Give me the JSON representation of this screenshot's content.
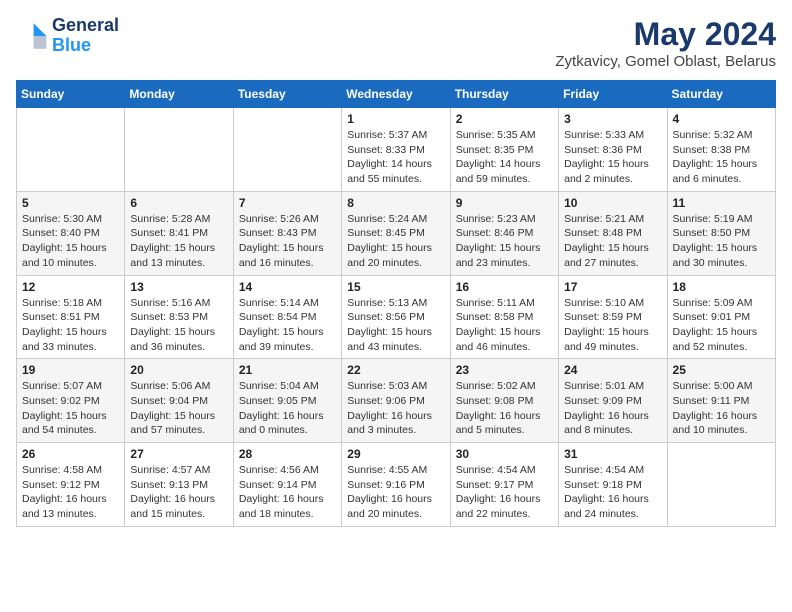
{
  "header": {
    "logo_line1": "General",
    "logo_line2": "Blue",
    "month": "May 2024",
    "location": "Zytkavicy, Gomel Oblast, Belarus"
  },
  "weekdays": [
    "Sunday",
    "Monday",
    "Tuesday",
    "Wednesday",
    "Thursday",
    "Friday",
    "Saturday"
  ],
  "weeks": [
    [
      {
        "day": "",
        "info": ""
      },
      {
        "day": "",
        "info": ""
      },
      {
        "day": "",
        "info": ""
      },
      {
        "day": "1",
        "info": "Sunrise: 5:37 AM\nSunset: 8:33 PM\nDaylight: 14 hours\nand 55 minutes."
      },
      {
        "day": "2",
        "info": "Sunrise: 5:35 AM\nSunset: 8:35 PM\nDaylight: 14 hours\nand 59 minutes."
      },
      {
        "day": "3",
        "info": "Sunrise: 5:33 AM\nSunset: 8:36 PM\nDaylight: 15 hours\nand 2 minutes."
      },
      {
        "day": "4",
        "info": "Sunrise: 5:32 AM\nSunset: 8:38 PM\nDaylight: 15 hours\nand 6 minutes."
      }
    ],
    [
      {
        "day": "5",
        "info": "Sunrise: 5:30 AM\nSunset: 8:40 PM\nDaylight: 15 hours\nand 10 minutes."
      },
      {
        "day": "6",
        "info": "Sunrise: 5:28 AM\nSunset: 8:41 PM\nDaylight: 15 hours\nand 13 minutes."
      },
      {
        "day": "7",
        "info": "Sunrise: 5:26 AM\nSunset: 8:43 PM\nDaylight: 15 hours\nand 16 minutes."
      },
      {
        "day": "8",
        "info": "Sunrise: 5:24 AM\nSunset: 8:45 PM\nDaylight: 15 hours\nand 20 minutes."
      },
      {
        "day": "9",
        "info": "Sunrise: 5:23 AM\nSunset: 8:46 PM\nDaylight: 15 hours\nand 23 minutes."
      },
      {
        "day": "10",
        "info": "Sunrise: 5:21 AM\nSunset: 8:48 PM\nDaylight: 15 hours\nand 27 minutes."
      },
      {
        "day": "11",
        "info": "Sunrise: 5:19 AM\nSunset: 8:50 PM\nDaylight: 15 hours\nand 30 minutes."
      }
    ],
    [
      {
        "day": "12",
        "info": "Sunrise: 5:18 AM\nSunset: 8:51 PM\nDaylight: 15 hours\nand 33 minutes."
      },
      {
        "day": "13",
        "info": "Sunrise: 5:16 AM\nSunset: 8:53 PM\nDaylight: 15 hours\nand 36 minutes."
      },
      {
        "day": "14",
        "info": "Sunrise: 5:14 AM\nSunset: 8:54 PM\nDaylight: 15 hours\nand 39 minutes."
      },
      {
        "day": "15",
        "info": "Sunrise: 5:13 AM\nSunset: 8:56 PM\nDaylight: 15 hours\nand 43 minutes."
      },
      {
        "day": "16",
        "info": "Sunrise: 5:11 AM\nSunset: 8:58 PM\nDaylight: 15 hours\nand 46 minutes."
      },
      {
        "day": "17",
        "info": "Sunrise: 5:10 AM\nSunset: 8:59 PM\nDaylight: 15 hours\nand 49 minutes."
      },
      {
        "day": "18",
        "info": "Sunrise: 5:09 AM\nSunset: 9:01 PM\nDaylight: 15 hours\nand 52 minutes."
      }
    ],
    [
      {
        "day": "19",
        "info": "Sunrise: 5:07 AM\nSunset: 9:02 PM\nDaylight: 15 hours\nand 54 minutes."
      },
      {
        "day": "20",
        "info": "Sunrise: 5:06 AM\nSunset: 9:04 PM\nDaylight: 15 hours\nand 57 minutes."
      },
      {
        "day": "21",
        "info": "Sunrise: 5:04 AM\nSunset: 9:05 PM\nDaylight: 16 hours\nand 0 minutes."
      },
      {
        "day": "22",
        "info": "Sunrise: 5:03 AM\nSunset: 9:06 PM\nDaylight: 16 hours\nand 3 minutes."
      },
      {
        "day": "23",
        "info": "Sunrise: 5:02 AM\nSunset: 9:08 PM\nDaylight: 16 hours\nand 5 minutes."
      },
      {
        "day": "24",
        "info": "Sunrise: 5:01 AM\nSunset: 9:09 PM\nDaylight: 16 hours\nand 8 minutes."
      },
      {
        "day": "25",
        "info": "Sunrise: 5:00 AM\nSunset: 9:11 PM\nDaylight: 16 hours\nand 10 minutes."
      }
    ],
    [
      {
        "day": "26",
        "info": "Sunrise: 4:58 AM\nSunset: 9:12 PM\nDaylight: 16 hours\nand 13 minutes."
      },
      {
        "day": "27",
        "info": "Sunrise: 4:57 AM\nSunset: 9:13 PM\nDaylight: 16 hours\nand 15 minutes."
      },
      {
        "day": "28",
        "info": "Sunrise: 4:56 AM\nSunset: 9:14 PM\nDaylight: 16 hours\nand 18 minutes."
      },
      {
        "day": "29",
        "info": "Sunrise: 4:55 AM\nSunset: 9:16 PM\nDaylight: 16 hours\nand 20 minutes."
      },
      {
        "day": "30",
        "info": "Sunrise: 4:54 AM\nSunset: 9:17 PM\nDaylight: 16 hours\nand 22 minutes."
      },
      {
        "day": "31",
        "info": "Sunrise: 4:54 AM\nSunset: 9:18 PM\nDaylight: 16 hours\nand 24 minutes."
      },
      {
        "day": "",
        "info": ""
      }
    ]
  ]
}
